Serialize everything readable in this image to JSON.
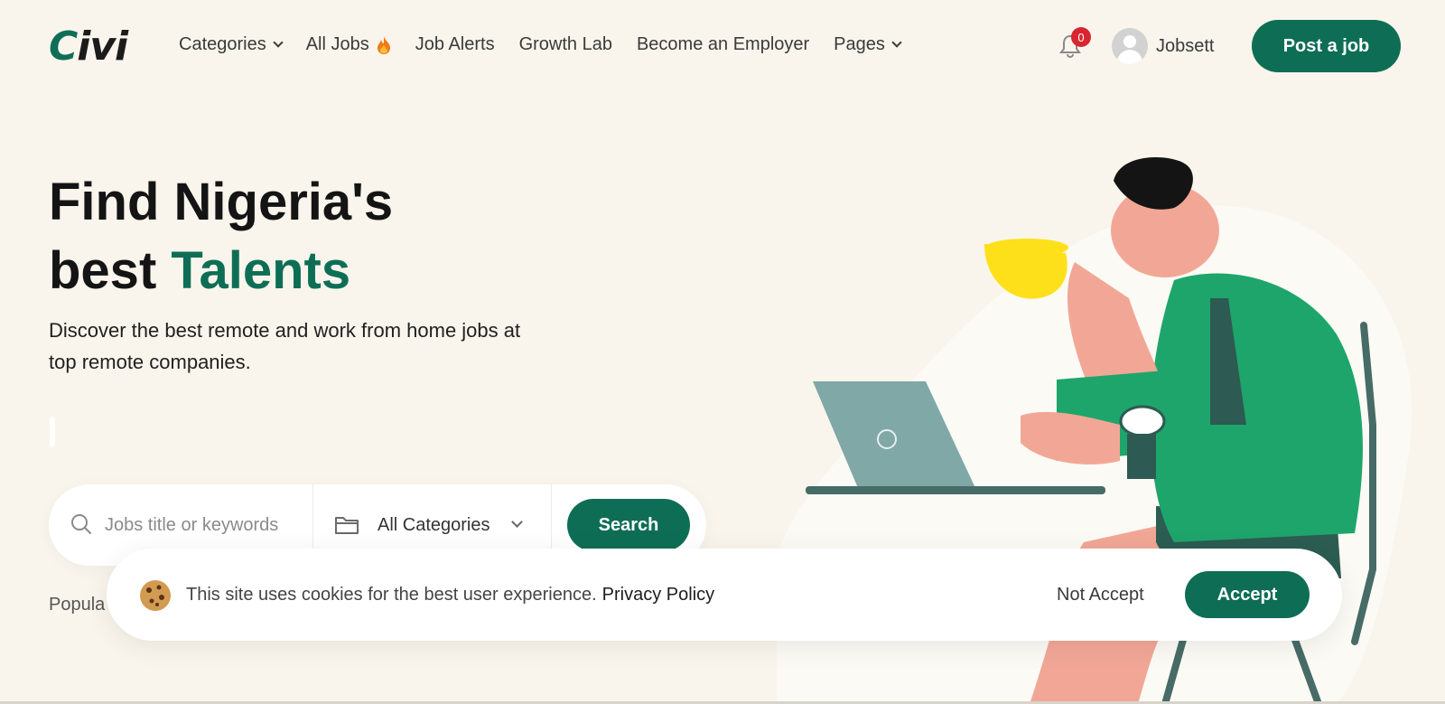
{
  "header": {
    "logo": {
      "first": "C",
      "rest": "ivi"
    },
    "nav": [
      {
        "label": "Categories",
        "has_dropdown": true
      },
      {
        "label": "All Jobs",
        "icon": "fire-icon"
      },
      {
        "label": "Job Alerts"
      },
      {
        "label": "Growth Lab"
      },
      {
        "label": "Become an Employer"
      },
      {
        "label": "Pages",
        "has_dropdown": true
      }
    ],
    "notification_count": "0",
    "username": "Jobsett",
    "post_button": "Post a job"
  },
  "hero": {
    "title_line1": "Find Nigeria's",
    "title_line2_plain": "best ",
    "title_line2_accent": "Talents",
    "subtitle": "Discover the best remote and work from home jobs at top remote companies."
  },
  "search": {
    "placeholder": "Jobs title or keywords",
    "category": "All Categories",
    "button": "Search"
  },
  "popular_label": "Popula",
  "cookie": {
    "text": "This site uses cookies for the best user experience.",
    "link": "Privacy Policy",
    "decline": "Not Accept",
    "accept": "Accept"
  },
  "colors": {
    "accent": "#0e6e55",
    "background": "#f9f5ec",
    "badge": "#d7262f"
  }
}
